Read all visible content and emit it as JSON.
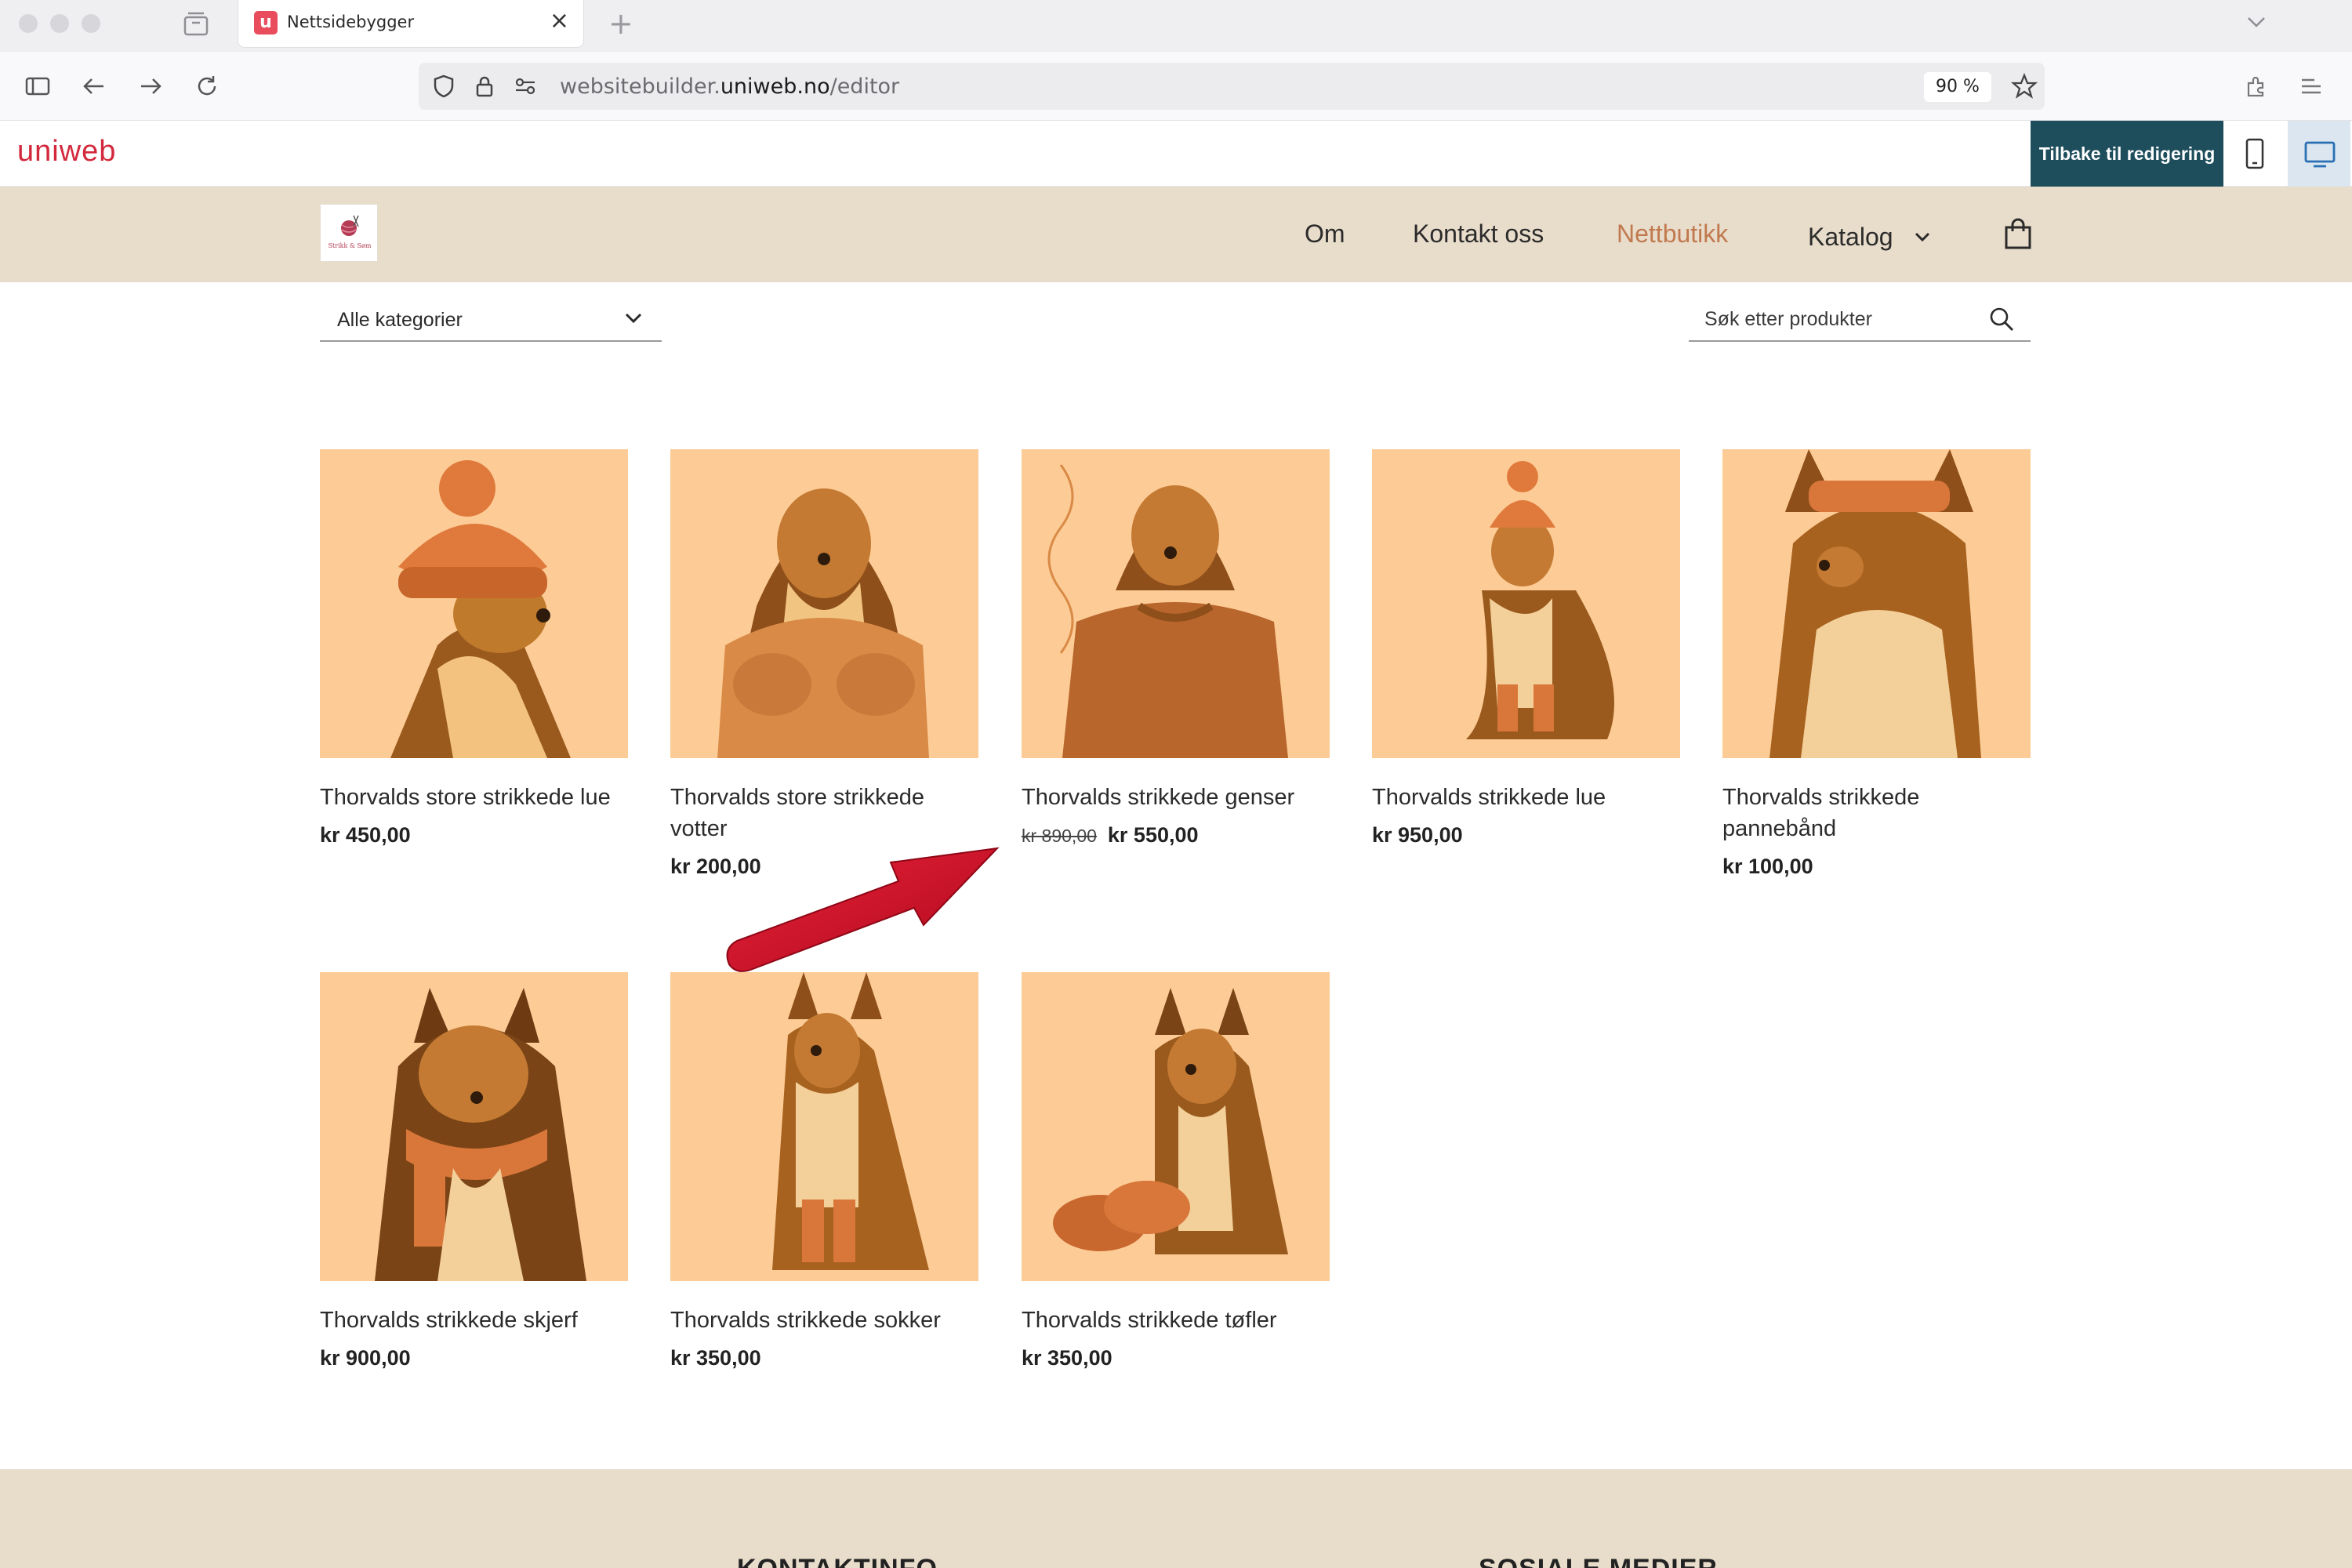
{
  "browser": {
    "tab_title": "Nettsidebygger",
    "tab_favicon_letter": "u",
    "url_prefix": "websitebuilder.",
    "url_domain": "uniweb.no",
    "url_path": "/editor",
    "zoom": "90 %"
  },
  "editor": {
    "logo": "uniweb",
    "back_label": "Tilbake til redigering"
  },
  "site": {
    "logo_text": "Strikk & Søm",
    "nav": [
      {
        "label": "Om"
      },
      {
        "label": "Kontakt oss"
      },
      {
        "label": "Nettbutikk",
        "active": true
      },
      {
        "label": "Katalog"
      }
    ]
  },
  "filters": {
    "category": "Alle kategorier",
    "search_placeholder": "Søk etter produkter"
  },
  "products": [
    {
      "name": "Thorvalds store strikkede lue",
      "price": "kr 450,00",
      "icon": "dog-in-beanie"
    },
    {
      "name": "Thorvalds store strikkede votter",
      "price": "kr 200,00",
      "icon": "dog-in-mittens"
    },
    {
      "name": "Thorvalds strikkede genser",
      "old_price": "kr 890,00",
      "price": "kr 550,00",
      "icon": "dog-in-sweater"
    },
    {
      "name": "Thorvalds strikkede lue",
      "price": "kr 950,00",
      "icon": "dog-sitting-beanie"
    },
    {
      "name": "Thorvalds strikkede pannebånd",
      "price": "kr 100,00",
      "icon": "dog-in-headband"
    },
    {
      "name": "Thorvalds strikkede skjerf",
      "price": "kr 900,00",
      "icon": "dog-in-scarf"
    },
    {
      "name": "Thorvalds strikkede sokker",
      "price": "kr 350,00",
      "icon": "dog-in-socks"
    },
    {
      "name": "Thorvalds strikkede tøfler",
      "price": "kr 350,00",
      "icon": "dog-with-slippers"
    }
  ],
  "colors": {
    "header_bg": "#e8dccb",
    "accent_nav": "#c17a4f",
    "editor_button": "#1e4d5c",
    "product_bg": "#fdcc96",
    "annotation_arrow": "#d0102a"
  }
}
